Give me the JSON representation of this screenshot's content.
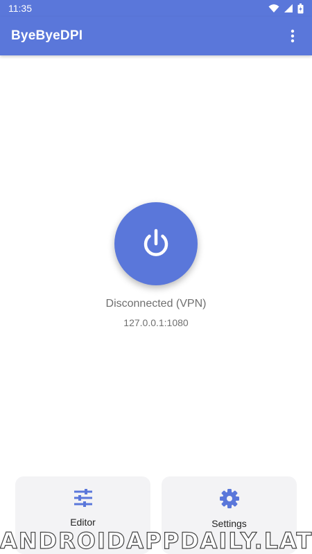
{
  "status_bar": {
    "time": "11:35",
    "icons": [
      "wifi-icon",
      "signal-icon",
      "battery-icon"
    ]
  },
  "app_bar": {
    "title": "ByeByeDPI",
    "menu_icon": "more-vert-icon"
  },
  "main": {
    "power_icon": "power-icon",
    "status": "Disconnected (VPN)",
    "address": "127.0.0.1:1080"
  },
  "cards": {
    "editor": {
      "label": "Editor",
      "icon": "tune-icon"
    },
    "settings": {
      "label": "Settings",
      "icon": "gear-icon"
    }
  },
  "watermark": "ANDROIDAPPDAILY.LAT",
  "colors": {
    "primary": "#5a77da",
    "card_bg": "#f3f3f5",
    "muted_text": "#6f6f6f"
  }
}
